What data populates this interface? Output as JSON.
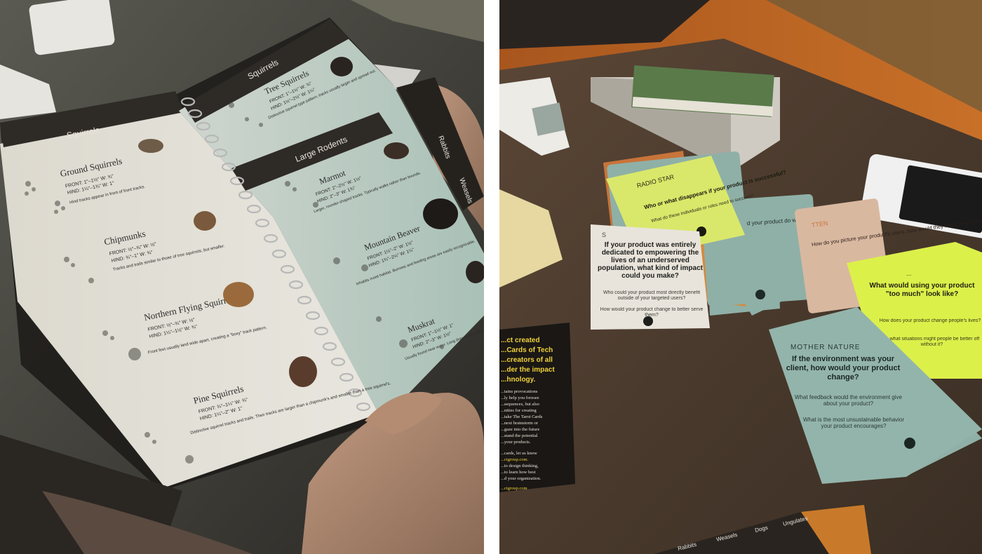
{
  "field_guide": {
    "left_page": {
      "header": "Squirrels",
      "sections": [
        {
          "name": "Ground Squirrels",
          "front": "FRONT: 1\"–1½\" W: ¾\"",
          "hind": "HIND: 1¼\"–1¾\" W: 1\"",
          "note": "Hind tracks appear in front of front tracks."
        },
        {
          "name": "Chipmunks",
          "front": "FRONT: ½\"–¾\" W: ½\"",
          "hind": "HIND: ¾\"–1\" W: ¾\"",
          "note": "Tracks and trails similar to those of tree squirrels, but smaller."
        },
        {
          "name": "Northern Flying Squirrel",
          "front": "FRONT: ½\"–¾\" W: ½\"",
          "hind": "HIND: 1¼\"–1½\" W: ¾\"",
          "note": "Front feet usually land wide apart, creating a \"boxy\" track pattern."
        },
        {
          "name": "Pine Squirrels",
          "front": "FRONT: ¾\"–1¼\" W: ¾\"",
          "hind": "HIND: 1¼\"–2\" W: 1\"",
          "note": "Distinctive squirrel tracks and trails. Their tracks are larger than a chipmunk's and smaller than a tree squirrel's."
        }
      ]
    },
    "right_page": {
      "header": "Squirrels",
      "top_section": {
        "name": "Tree Squirrels",
        "front": "FRONT: 1\"–1½\" W: ¾\"",
        "hind": "HIND: 1½\"–2½\" W: 1¼\"",
        "note": "Distinctive squirrel-type pattern; tracks usually larger and spread out."
      },
      "section_header": "Large Rodents",
      "sections": [
        {
          "name": "Marmot",
          "front": "FRONT: 2\"–2½\" W: 1½\"",
          "hind": "HIND: 2\"–3\" W: 1¾\"",
          "note": "Larger, rounder-shaped tracks. Typically walks rather than bounds."
        },
        {
          "name": "Mountain Beaver",
          "front": "FRONT: 1½\"–2\" W: 1½\"",
          "hind": "HIND: 1¾\"–2¼\" W: 1¼\"",
          "note": "Inhabits moist habitat. Burrows and feeding areas are easily recognizable."
        },
        {
          "name": "Muskrat",
          "front": "FRONT: 1\"–1½\" W: 1\"",
          "hind": "HIND: 2\"–3\" W: 1½\"",
          "note": "Usually found near water. Long drag marks often seen."
        }
      ],
      "side_tabs": [
        "Rabbits",
        "Weasels"
      ]
    },
    "bottom_tabs": [
      "Rabbits",
      "Weasels",
      "Dogs",
      "Ungulates"
    ]
  },
  "cards": {
    "radio_star": {
      "title": "RADIO STAR",
      "question": "Who or what disappears if your product is successful?",
      "sub": "What do these individuals or roles need to succeed?"
    },
    "underserved": {
      "title": "S",
      "question": "If your product was entirely dedicated to empowering the lives of an underserved population, what kind of impact could you make?",
      "sub1": "Who could your product most directly benefit outside of your targeted users?",
      "sub2": "How would your product change to better serve them?"
    },
    "mother_nature": {
      "title": "MOTHER NATURE",
      "question": "If the environment was your client, how would your product change?",
      "sub1": "What feedback would the environment give about your product?",
      "sub2": "What is the most unsustainable behavior your product encourages?"
    },
    "excess": {
      "title": "...",
      "question": "What would using your product \"too much\" look like?",
      "sub1": "How does your product change people's lives?",
      "sub2": "In what situations might people be better off without it?"
    },
    "peach": {
      "title": "TTEN",
      "question": "How do you picture your product's users, how would they feel if they used your product for a lifetime?"
    },
    "teal_middle": {
      "question": "...would your product do with ... your product?"
    },
    "black_card": {
      "lines": [
        "...ct created",
        "...Cards of Tech",
        "...creators of all",
        "...der the impact",
        "...hnology."
      ],
      "body": [
        "...tains provocations",
        "...ly help you foresee",
        "...sequences, but also",
        "...nities for creating",
        "...take The Tarot Cards",
        "...next brainstorm or",
        "...gaze into the future",
        "...stand the potential",
        "...your products."
      ],
      "footer": [
        "...cards, let us know",
        "...to design thinking,",
        "...to learn how best",
        "...d your organization."
      ],
      "urls": [
        "...ctgroup.com.",
        "...ctgroup.com"
      ]
    }
  },
  "colors": {
    "card_yellow": "#d9e86a",
    "card_teal": "#8fb0a7",
    "card_white": "#e8e4dc",
    "card_peach": "#d9b8a0",
    "card_lime": "#dcf04a",
    "card_black": "#1a1714",
    "accent_yellow": "#f0d23a",
    "table": "#4a3a2e"
  },
  "icons": [
    "eye-icon"
  ]
}
